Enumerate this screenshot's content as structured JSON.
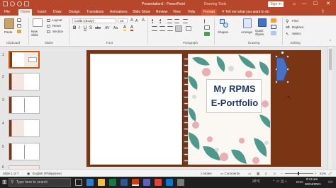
{
  "window": {
    "title": "Presentation1 - PowerPoint",
    "drawing_tools": "Drawing Tools",
    "tell_me": "Tell me what you want to do",
    "sign_in": "Sign in",
    "minimize": "—",
    "maximize": "☐",
    "close": "✕"
  },
  "tabs": [
    "File",
    "Home",
    "Insert",
    "Draw",
    "Design",
    "Transitions",
    "Animations",
    "Slide Show",
    "Review",
    "View",
    "Help",
    "Format"
  ],
  "ribbon": {
    "clipboard": {
      "paste": "Paste",
      "group": "Clipboard"
    },
    "slides": {
      "new_slide": "New Slide",
      "layout": "Layout",
      "reset": "Reset",
      "section": "Section",
      "group": "Slides"
    },
    "font": {
      "name": "Calibri (Body)",
      "size": "18",
      "group": "Font"
    },
    "paragraph": {
      "group": "Paragraph"
    },
    "drawing": {
      "shapes": "Shapes",
      "arrange": "Arrange",
      "quick_styles": "Quick Styles",
      "group": "Drawing"
    },
    "editing": {
      "find": "Find",
      "replace": "Replace",
      "select": "Select",
      "group": "Editing"
    }
  },
  "slides": [
    {
      "number": "1"
    },
    {
      "number": "2"
    },
    {
      "number": "3"
    },
    {
      "number": "4"
    },
    {
      "number": "5"
    },
    {
      "number": "6"
    }
  ],
  "slide": {
    "title_line1": "My RPMS",
    "title_line2": "E-Portfolio"
  },
  "status": {
    "slide_info": "Slide 1 of 7",
    "language": "English (Philippines)",
    "notes": "Notes",
    "comments": "Comments",
    "zoom": "63%"
  },
  "taskbar": {
    "search_placeholder": "Type here to search",
    "temperature": "26°C",
    "lang": "ENG",
    "time": "9:14 am",
    "date": "30/04/2021"
  },
  "colors": {
    "brand": "#b7472a",
    "binder": "#7a3514",
    "selection_tab": "#4472c4",
    "title_text": "#1f3a68"
  }
}
